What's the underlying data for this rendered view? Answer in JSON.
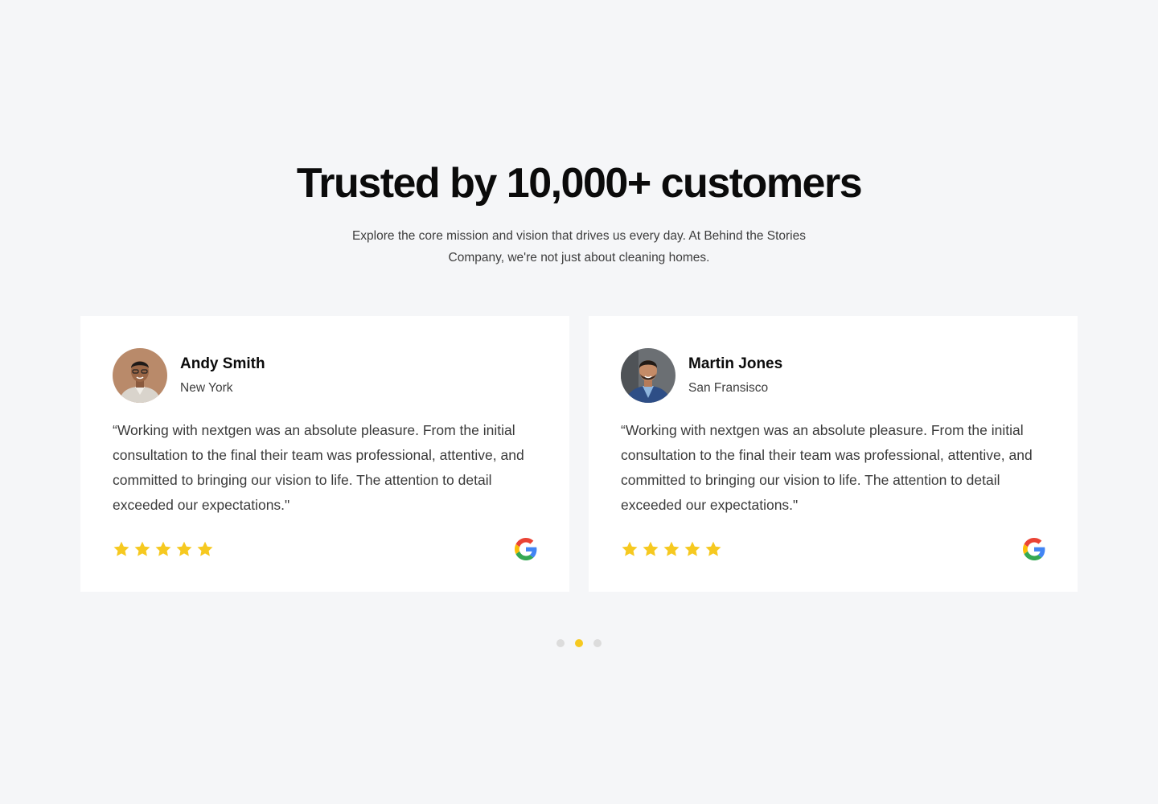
{
  "section": {
    "title": "Trusted by 10,000+ customers",
    "subtitle": "Explore the core mission and vision that drives us every day. At Behind the Stories Company, we're not just about cleaning homes."
  },
  "testimonials": [
    {
      "name": "Andy Smith",
      "location": "New York",
      "quote": "“Working with nextgen was an absolute pleasure. From the initial consultation to the final their team was professional, attentive, and committed to bringing our vision to life. The attention to detail exceeded our expectations.\"",
      "rating": 5,
      "source_icon": "google-icon",
      "avatar_icon": "avatar-photo"
    },
    {
      "name": "Martin Jones",
      "location": "San Fransisco",
      "quote": "“Working with nextgen was an absolute pleasure. From the initial consultation to the final their team was professional, attentive, and committed to bringing our vision to life. The attention to detail exceeded our expectations.\"",
      "rating": 5,
      "source_icon": "google-icon",
      "avatar_icon": "avatar-photo"
    }
  ],
  "pagination": {
    "count": 3,
    "active_index": 1
  },
  "colors": {
    "background": "#f5f6f8",
    "card": "#ffffff",
    "star": "#f6c920",
    "dot_active": "#f6c920",
    "dot_inactive": "#dcdcdc"
  }
}
